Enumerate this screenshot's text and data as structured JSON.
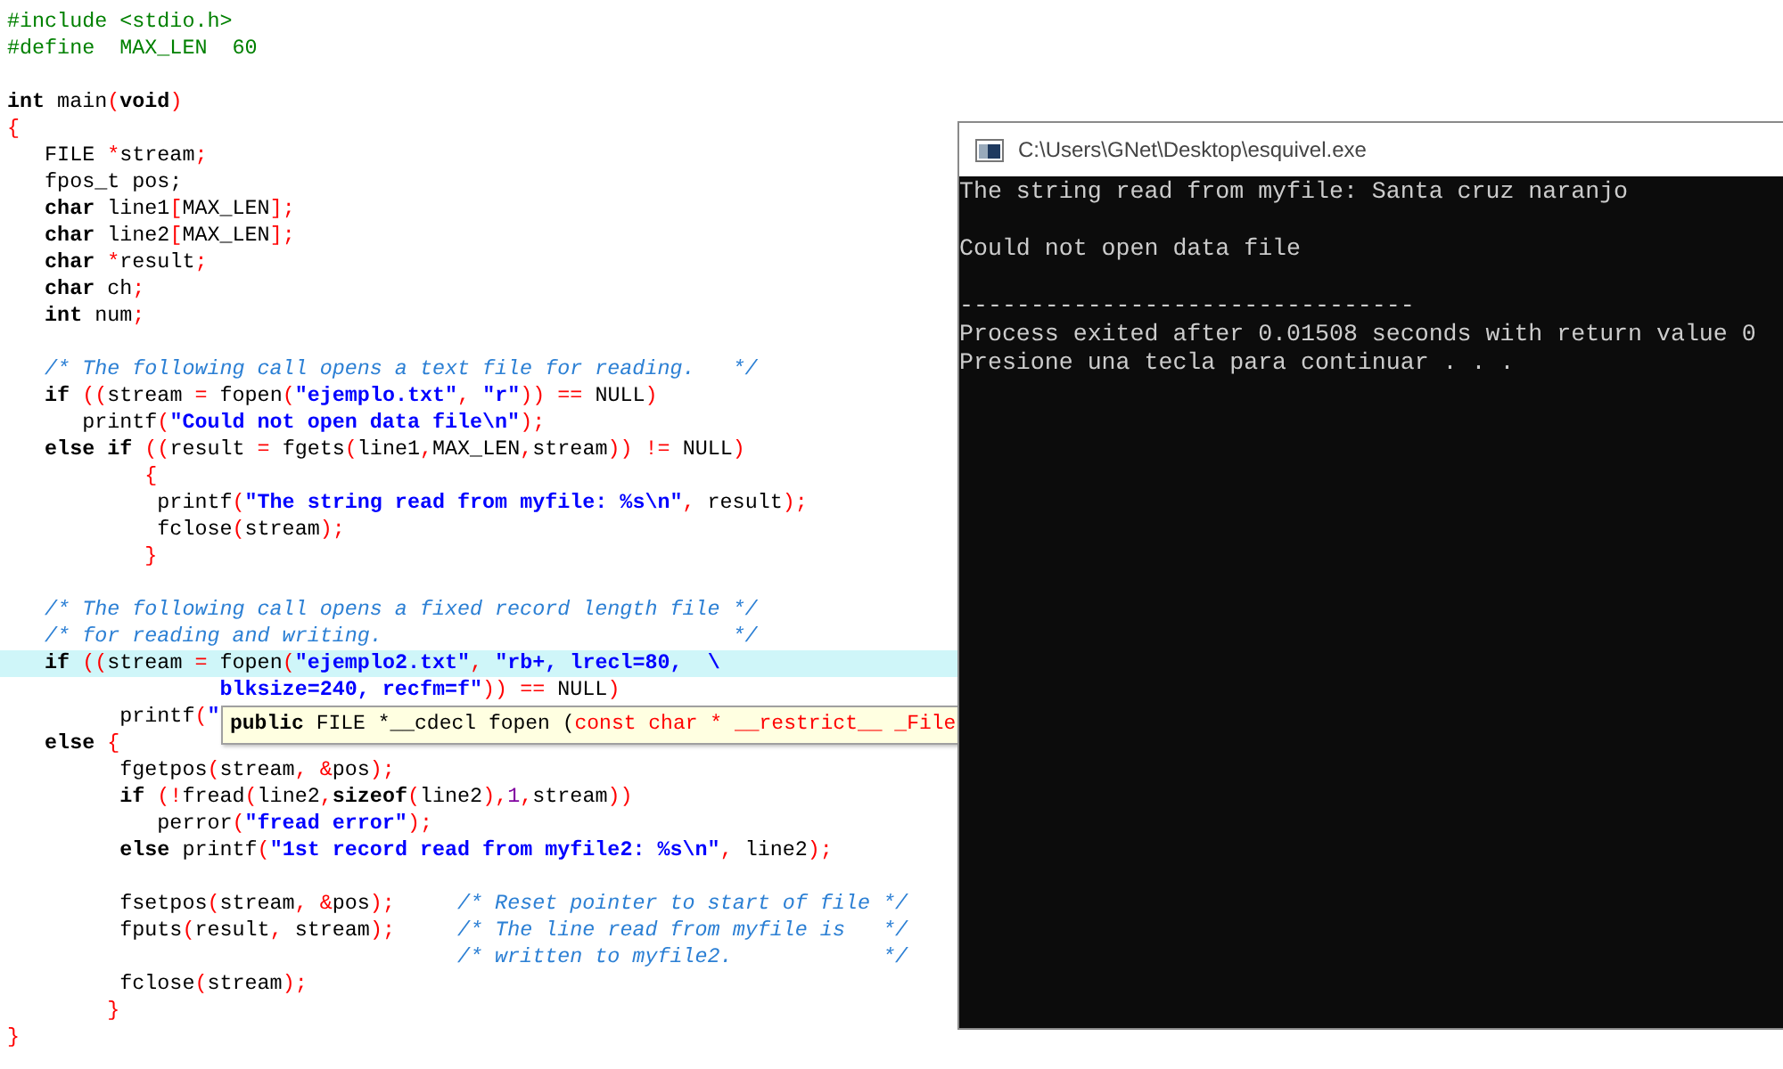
{
  "editor": {
    "blocks": [
      {
        "lines": [
          {
            "highlighted": false,
            "tokens": [
              {
                "kind": "pp",
                "text": "#include <stdio.h>"
              }
            ]
          },
          {
            "highlighted": false,
            "tokens": [
              {
                "kind": "pp",
                "text": "#define  MAX_LEN  60"
              }
            ]
          }
        ]
      },
      {
        "lines": [
          {
            "highlighted": false,
            "tokens": [
              {
                "kind": "kw",
                "text": "int"
              },
              {
                "kind": "id",
                "text": " main"
              },
              {
                "kind": "op",
                "text": "("
              },
              {
                "kind": "kw",
                "text": "void"
              },
              {
                "kind": "op",
                "text": ")"
              }
            ]
          },
          {
            "highlighted": false,
            "tokens": [
              {
                "kind": "op",
                "text": "{"
              }
            ]
          },
          {
            "highlighted": false,
            "tokens": [
              {
                "kind": "id",
                "text": "   FILE "
              },
              {
                "kind": "op",
                "text": "*"
              },
              {
                "kind": "id",
                "text": "stream"
              },
              {
                "kind": "op",
                "text": ";"
              }
            ]
          },
          {
            "highlighted": false,
            "tokens": [
              {
                "kind": "id",
                "text": "   fpos_t pos;"
              }
            ]
          },
          {
            "highlighted": false,
            "tokens": [
              {
                "kind": "kw",
                "text": "   char"
              },
              {
                "kind": "id",
                "text": " line1"
              },
              {
                "kind": "op",
                "text": "["
              },
              {
                "kind": "id",
                "text": "MAX_LEN"
              },
              {
                "kind": "op",
                "text": "];"
              }
            ]
          },
          {
            "highlighted": false,
            "tokens": [
              {
                "kind": "kw",
                "text": "   char"
              },
              {
                "kind": "id",
                "text": " line2"
              },
              {
                "kind": "op",
                "text": "["
              },
              {
                "kind": "id",
                "text": "MAX_LEN"
              },
              {
                "kind": "op",
                "text": "];"
              }
            ]
          },
          {
            "highlighted": false,
            "tokens": [
              {
                "kind": "kw",
                "text": "   char"
              },
              {
                "kind": "op",
                "text": " *"
              },
              {
                "kind": "id",
                "text": "result"
              },
              {
                "kind": "op",
                "text": ";"
              }
            ]
          },
          {
            "highlighted": false,
            "tokens": [
              {
                "kind": "kw",
                "text": "   char"
              },
              {
                "kind": "id",
                "text": " ch"
              },
              {
                "kind": "op",
                "text": ";"
              }
            ]
          },
          {
            "highlighted": false,
            "tokens": [
              {
                "kind": "kw",
                "text": "   int"
              },
              {
                "kind": "id",
                "text": " num"
              },
              {
                "kind": "op",
                "text": ";"
              }
            ]
          }
        ]
      },
      {
        "lines": [
          {
            "highlighted": false,
            "tokens": [
              {
                "kind": "cm",
                "text": "   /* The following call opens a text file for reading.   */"
              }
            ]
          },
          {
            "highlighted": false,
            "tokens": [
              {
                "kind": "kw",
                "text": "   if"
              },
              {
                "kind": "op",
                "text": " (("
              },
              {
                "kind": "id",
                "text": "stream "
              },
              {
                "kind": "op",
                "text": "="
              },
              {
                "kind": "id",
                "text": " fopen"
              },
              {
                "kind": "op",
                "text": "("
              },
              {
                "kind": "str",
                "text": "\"ejemplo.txt\""
              },
              {
                "kind": "op",
                "text": ", "
              },
              {
                "kind": "str",
                "text": "\"r\""
              },
              {
                "kind": "op",
                "text": ")) =="
              },
              {
                "kind": "id",
                "text": " NULL"
              },
              {
                "kind": "op",
                "text": ")"
              }
            ]
          },
          {
            "highlighted": false,
            "tokens": [
              {
                "kind": "id",
                "text": "      printf"
              },
              {
                "kind": "op",
                "text": "("
              },
              {
                "kind": "str",
                "text": "\"Could not open data file\\n\""
              },
              {
                "kind": "op",
                "text": ");"
              }
            ]
          },
          {
            "highlighted": false,
            "tokens": [
              {
                "kind": "kw",
                "text": "   else if"
              },
              {
                "kind": "op",
                "text": " (("
              },
              {
                "kind": "id",
                "text": "result "
              },
              {
                "kind": "op",
                "text": "="
              },
              {
                "kind": "id",
                "text": " fgets"
              },
              {
                "kind": "op",
                "text": "("
              },
              {
                "kind": "id",
                "text": "line1"
              },
              {
                "kind": "op",
                "text": ","
              },
              {
                "kind": "id",
                "text": "MAX_LEN"
              },
              {
                "kind": "op",
                "text": ","
              },
              {
                "kind": "id",
                "text": "stream"
              },
              {
                "kind": "op",
                "text": ")) !="
              },
              {
                "kind": "id",
                "text": " NULL"
              },
              {
                "kind": "op",
                "text": ")"
              }
            ]
          },
          {
            "highlighted": false,
            "tokens": [
              {
                "kind": "op",
                "text": "           {"
              }
            ]
          },
          {
            "highlighted": false,
            "tokens": [
              {
                "kind": "id",
                "text": "            printf"
              },
              {
                "kind": "op",
                "text": "("
              },
              {
                "kind": "str",
                "text": "\"The string read from myfile: %s\\n\""
              },
              {
                "kind": "op",
                "text": ", "
              },
              {
                "kind": "id",
                "text": "result"
              },
              {
                "kind": "op",
                "text": ");"
              }
            ]
          },
          {
            "highlighted": false,
            "tokens": [
              {
                "kind": "id",
                "text": "            fclose"
              },
              {
                "kind": "op",
                "text": "("
              },
              {
                "kind": "id",
                "text": "stream"
              },
              {
                "kind": "op",
                "text": ");"
              }
            ]
          },
          {
            "highlighted": false,
            "tokens": [
              {
                "kind": "op",
                "text": "           }"
              }
            ]
          }
        ]
      },
      {
        "lines": [
          {
            "highlighted": false,
            "tokens": [
              {
                "kind": "cm",
                "text": "   /* The following call opens a fixed record length file */"
              }
            ]
          },
          {
            "highlighted": false,
            "tokens": [
              {
                "kind": "cm",
                "text": "   /* for reading and writing.                            */"
              }
            ]
          },
          {
            "highlighted": true,
            "tokens": [
              {
                "kind": "kw",
                "text": "   if"
              },
              {
                "kind": "op",
                "text": " (("
              },
              {
                "kind": "id",
                "text": "stream "
              },
              {
                "kind": "op",
                "text": "="
              },
              {
                "kind": "id",
                "text": " fopen"
              },
              {
                "kind": "op",
                "text": "("
              },
              {
                "kind": "str",
                "text": "\"ejemplo2.txt\""
              },
              {
                "kind": "op",
                "text": ", "
              },
              {
                "kind": "str",
                "text": "\"rb+, lrecl=80,  \\"
              }
            ]
          },
          {
            "highlighted": false,
            "tokens": [
              {
                "kind": "str",
                "text": "                 blksize=240, recfm=f\""
              },
              {
                "kind": "op",
                "text": ")) =="
              },
              {
                "kind": "id",
                "text": " NULL"
              },
              {
                "kind": "op",
                "text": ")"
              }
            ]
          },
          {
            "highlighted": false,
            "tokens": [
              {
                "kind": "id",
                "text": "         printf"
              },
              {
                "kind": "op",
                "text": "("
              },
              {
                "kind": "str",
                "text": "\""
              }
            ]
          },
          {
            "highlighted": false,
            "tokens": [
              {
                "kind": "kw",
                "text": "   else"
              },
              {
                "kind": "op",
                "text": " {"
              }
            ]
          },
          {
            "highlighted": false,
            "tokens": [
              {
                "kind": "id",
                "text": "         fgetpos"
              },
              {
                "kind": "op",
                "text": "("
              },
              {
                "kind": "id",
                "text": "stream"
              },
              {
                "kind": "op",
                "text": ", &"
              },
              {
                "kind": "id",
                "text": "pos"
              },
              {
                "kind": "op",
                "text": ");"
              }
            ]
          },
          {
            "highlighted": false,
            "tokens": [
              {
                "kind": "kw",
                "text": "         if"
              },
              {
                "kind": "op",
                "text": " (!"
              },
              {
                "kind": "id",
                "text": "fread"
              },
              {
                "kind": "op",
                "text": "("
              },
              {
                "kind": "id",
                "text": "line2"
              },
              {
                "kind": "op",
                "text": ","
              },
              {
                "kind": "kw",
                "text": "sizeof"
              },
              {
                "kind": "op",
                "text": "("
              },
              {
                "kind": "id",
                "text": "line2"
              },
              {
                "kind": "op",
                "text": "),"
              },
              {
                "kind": "num",
                "text": "1"
              },
              {
                "kind": "op",
                "text": ","
              },
              {
                "kind": "id",
                "text": "stream"
              },
              {
                "kind": "op",
                "text": "))"
              }
            ]
          },
          {
            "highlighted": false,
            "tokens": [
              {
                "kind": "id",
                "text": "            perror"
              },
              {
                "kind": "op",
                "text": "("
              },
              {
                "kind": "str",
                "text": "\"fread error\""
              },
              {
                "kind": "op",
                "text": ");"
              }
            ]
          },
          {
            "highlighted": false,
            "tokens": [
              {
                "kind": "kw",
                "text": "         else"
              },
              {
                "kind": "id",
                "text": " printf"
              },
              {
                "kind": "op",
                "text": "("
              },
              {
                "kind": "str",
                "text": "\"1st record read from myfile2: %s\\n\""
              },
              {
                "kind": "op",
                "text": ", "
              },
              {
                "kind": "id",
                "text": "line2"
              },
              {
                "kind": "op",
                "text": ");"
              }
            ]
          }
        ]
      },
      {
        "lines": [
          {
            "highlighted": false,
            "tokens": [
              {
                "kind": "id",
                "text": "         fsetpos"
              },
              {
                "kind": "op",
                "text": "("
              },
              {
                "kind": "id",
                "text": "stream"
              },
              {
                "kind": "op",
                "text": ", &"
              },
              {
                "kind": "id",
                "text": "pos"
              },
              {
                "kind": "op",
                "text": ");"
              },
              {
                "kind": "cm",
                "text": "     /* Reset pointer to start of file */"
              }
            ]
          },
          {
            "highlighted": false,
            "tokens": [
              {
                "kind": "id",
                "text": "         fputs"
              },
              {
                "kind": "op",
                "text": "("
              },
              {
                "kind": "id",
                "text": "result"
              },
              {
                "kind": "op",
                "text": ", "
              },
              {
                "kind": "id",
                "text": "stream"
              },
              {
                "kind": "op",
                "text": ");"
              },
              {
                "kind": "cm",
                "text": "     /* The line read from myfile is   */"
              }
            ]
          },
          {
            "highlighted": false,
            "tokens": [
              {
                "kind": "cm",
                "text": "                                    /* written to myfile2.            */"
              }
            ]
          },
          {
            "highlighted": false,
            "tokens": [
              {
                "kind": "id",
                "text": "         fclose"
              },
              {
                "kind": "op",
                "text": "("
              },
              {
                "kind": "id",
                "text": "stream"
              },
              {
                "kind": "op",
                "text": ");"
              }
            ]
          },
          {
            "highlighted": false,
            "tokens": [
              {
                "kind": "op",
                "text": "        }"
              }
            ]
          },
          {
            "highlighted": false,
            "tokens": [
              {
                "kind": "op",
                "text": "}"
              }
            ]
          }
        ]
      }
    ]
  },
  "tooltip": {
    "tokens": [
      {
        "kind": "kw",
        "text": "public"
      },
      {
        "kind": "id",
        "text": " FILE *__cdecl fopen ("
      },
      {
        "kind": "op",
        "text": "const char * __restrict__ _File"
      }
    ]
  },
  "console": {
    "title": "C:\\Users\\GNet\\Desktop\\esquivel.exe",
    "blocks": [
      [
        "The string read from myfile: Santa cruz naranjo"
      ],
      [
        "Could not open data file"
      ],
      [
        "--------------------------------",
        "Process exited after 0.01508 seconds with return value 0",
        "Presione una tecla para continuar . . ."
      ]
    ]
  }
}
